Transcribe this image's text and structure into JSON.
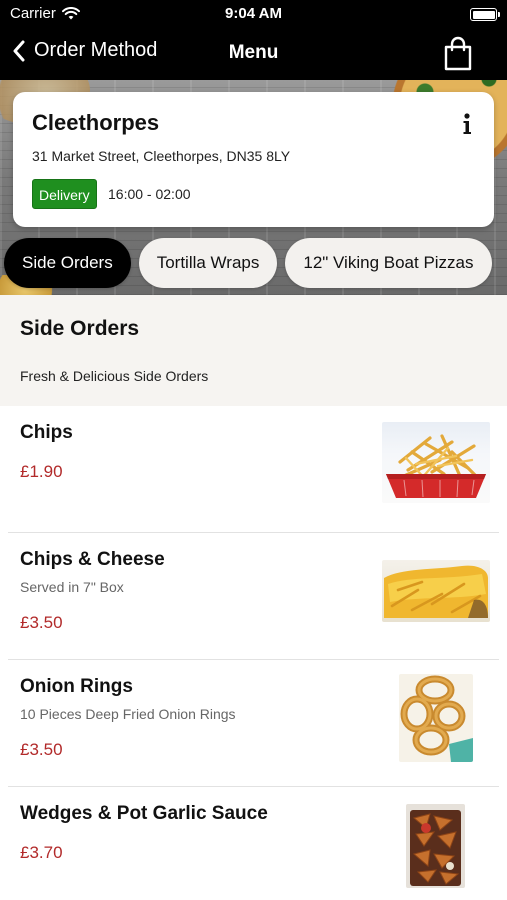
{
  "status_bar": {
    "carrier": "Carrier",
    "time": "9:04 AM"
  },
  "nav": {
    "back_label": "Order Method",
    "title": "Menu"
  },
  "store": {
    "name": "Cleethorpes",
    "address": "31 Market Street, Cleethorpes, DN35 8LY",
    "badge": "Delivery",
    "hours": "16:00 - 02:00"
  },
  "categories": [
    {
      "label": "Side Orders",
      "active": true
    },
    {
      "label": "Tortilla Wraps",
      "active": false
    },
    {
      "label": "12\" Viking Boat Pizzas",
      "active": false
    }
  ],
  "section": {
    "title": "Side Orders",
    "subtitle": "Fresh & Delicious Side Orders"
  },
  "items": [
    {
      "name": "Chips",
      "description": "",
      "price": "£1.90"
    },
    {
      "name": "Chips & Cheese",
      "description": "Served in 7\" Box",
      "price": "£3.50"
    },
    {
      "name": "Onion Rings",
      "description": "10 Pieces Deep Fried Onion Rings",
      "price": "£3.50"
    },
    {
      "name": "Wedges & Pot Garlic Sauce",
      "description": "",
      "price": "£3.70"
    }
  ],
  "colors": {
    "delivery": "#1f8f1f",
    "price": "#b22a2a",
    "active_tab": "#000000"
  },
  "icons": {
    "back": "chevron-left-icon",
    "bag": "shopping-bag-icon",
    "info": "info-icon",
    "wifi": "wifi-icon",
    "battery": "battery-icon"
  }
}
